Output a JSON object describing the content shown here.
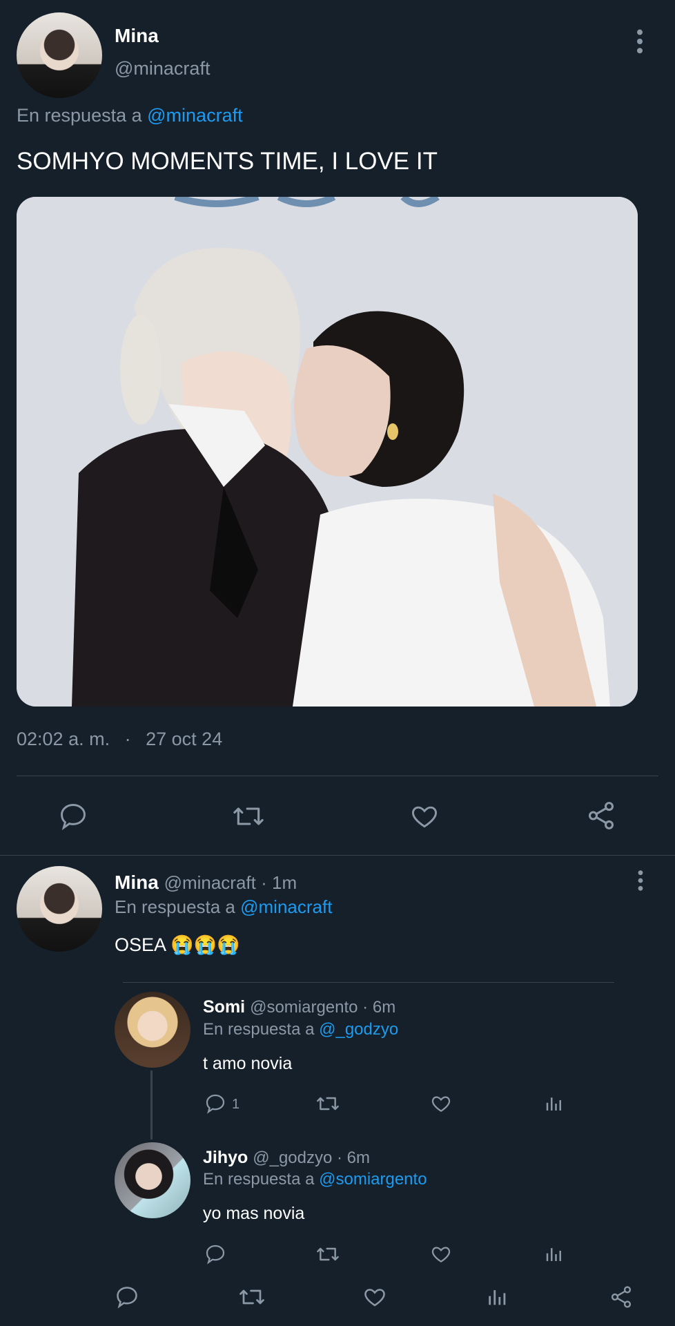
{
  "main_tweet": {
    "author_name": "Mina",
    "author_handle": "@minacraft",
    "reply_prefix": "En respuesta a",
    "reply_to": "@minacraft",
    "text": "SOMHYO MOMENTS TIME, I LOVE IT",
    "time": "02:02 a. m.",
    "dot": "·",
    "date": "27 oct 24"
  },
  "reply_tweet": {
    "author_name": "Mina",
    "author_handle": "@minacraft · 1m",
    "reply_prefix": "En respuesta a",
    "reply_to": "@minacraft",
    "text": "OSEA 😭😭😭"
  },
  "quoted_thread": [
    {
      "author_name": "Somi",
      "author_handle": "@somiargento · 6m",
      "reply_prefix": "En respuesta a",
      "reply_to": "@_godzyo",
      "text": "t amo novia",
      "reply_count": "1"
    },
    {
      "author_name": "Jihyo",
      "author_handle": "@_godzyo · 6m",
      "reply_prefix": "En respuesta a",
      "reply_to": "@somiargento",
      "text": "yo mas novia",
      "reply_count": ""
    }
  ],
  "icons": {
    "more": "more-vertical-icon",
    "reply": "reply-icon",
    "retweet": "retweet-icon",
    "like": "heart-icon",
    "share": "share-icon",
    "views": "views-icon"
  },
  "colors": {
    "background": "#15202b",
    "link": "#1d9bf0",
    "muted": "#8b98a5",
    "divider": "#38444d"
  }
}
